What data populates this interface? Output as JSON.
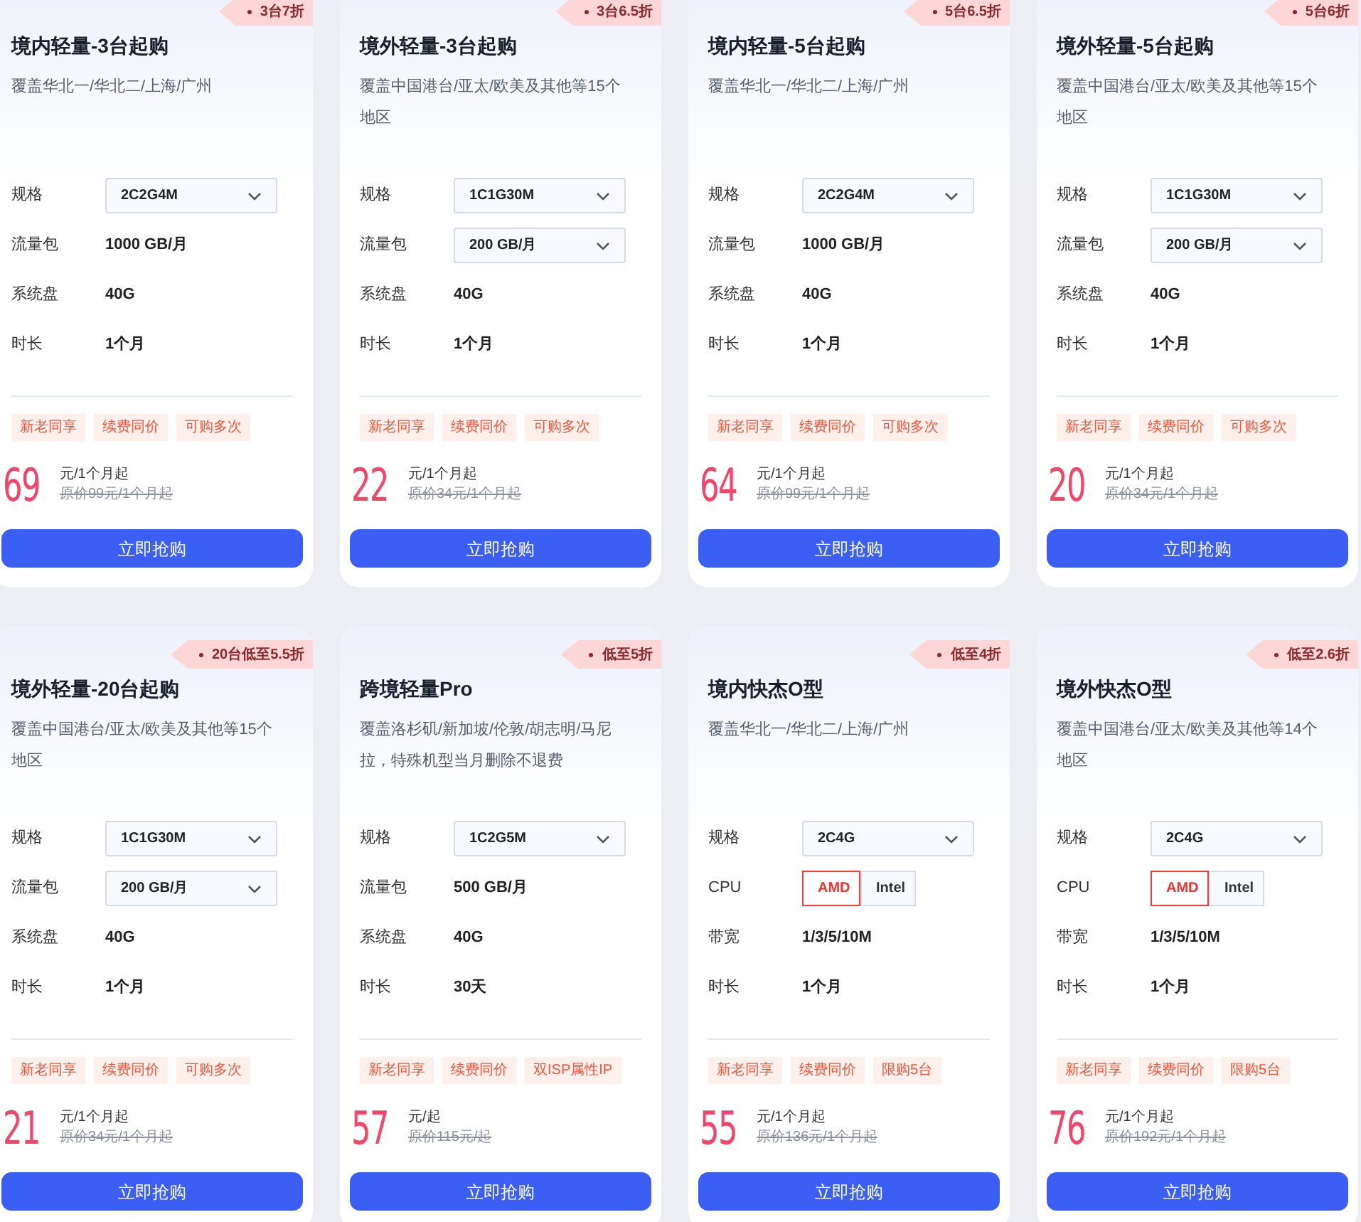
{
  "cards": [
    {
      "badge": "3台7折",
      "title": "境内轻量-3台起购",
      "description": "覆盖华北一/华北二/上海/广州",
      "specs": [
        {
          "label": "规格",
          "kind": "select",
          "value": "2C2G4M"
        },
        {
          "label": "流量包",
          "kind": "text",
          "value": "1000 GB/月"
        },
        {
          "label": "系统盘",
          "kind": "text",
          "value": "40G"
        },
        {
          "label": "时长",
          "kind": "text",
          "value": "1个月"
        }
      ],
      "tags": [
        "新老同享",
        "续费同价",
        "可购多次"
      ],
      "price": "69",
      "unit": "元/1个月起",
      "original_price": "原价99元/1个月起",
      "button": "立即抢购"
    },
    {
      "badge": "3台6.5折",
      "title": "境外轻量-3台起购",
      "description": "覆盖中国港台/亚太/欧美及其他等15个地区",
      "specs": [
        {
          "label": "规格",
          "kind": "select",
          "value": "1C1G30M"
        },
        {
          "label": "流量包",
          "kind": "select",
          "value": "200 GB/月"
        },
        {
          "label": "系统盘",
          "kind": "text",
          "value": "40G"
        },
        {
          "label": "时长",
          "kind": "text",
          "value": "1个月"
        }
      ],
      "tags": [
        "新老同享",
        "续费同价",
        "可购多次"
      ],
      "price": "22",
      "unit": "元/1个月起",
      "original_price": "原价34元/1个月起",
      "button": "立即抢购"
    },
    {
      "badge": "5台6.5折",
      "title": "境内轻量-5台起购",
      "description": "覆盖华北一/华北二/上海/广州",
      "specs": [
        {
          "label": "规格",
          "kind": "select",
          "value": "2C2G4M"
        },
        {
          "label": "流量包",
          "kind": "text",
          "value": "1000 GB/月"
        },
        {
          "label": "系统盘",
          "kind": "text",
          "value": "40G"
        },
        {
          "label": "时长",
          "kind": "text",
          "value": "1个月"
        }
      ],
      "tags": [
        "新老同享",
        "续费同价",
        "可购多次"
      ],
      "price": "64",
      "unit": "元/1个月起",
      "original_price": "原价99元/1个月起",
      "button": "立即抢购"
    },
    {
      "badge": "5台6折",
      "title": "境外轻量-5台起购",
      "description": "覆盖中国港台/亚太/欧美及其他等15个地区",
      "specs": [
        {
          "label": "规格",
          "kind": "select",
          "value": "1C1G30M"
        },
        {
          "label": "流量包",
          "kind": "select",
          "value": "200 GB/月"
        },
        {
          "label": "系统盘",
          "kind": "text",
          "value": "40G"
        },
        {
          "label": "时长",
          "kind": "text",
          "value": "1个月"
        }
      ],
      "tags": [
        "新老同享",
        "续费同价",
        "可购多次"
      ],
      "price": "20",
      "unit": "元/1个月起",
      "original_price": "原价34元/1个月起",
      "button": "立即抢购"
    },
    {
      "badge": "20台低至5.5折",
      "title": "境外轻量-20台起购",
      "description": "覆盖中国港台/亚太/欧美及其他等15个地区",
      "specs": [
        {
          "label": "规格",
          "kind": "select",
          "value": "1C1G30M"
        },
        {
          "label": "流量包",
          "kind": "select",
          "value": "200 GB/月"
        },
        {
          "label": "系统盘",
          "kind": "text",
          "value": "40G"
        },
        {
          "label": "时长",
          "kind": "text",
          "value": "1个月"
        }
      ],
      "tags": [
        "新老同享",
        "续费同价",
        "可购多次"
      ],
      "price": "21",
      "unit": "元/1个月起",
      "original_price": "原价34元/1个月起",
      "button": "立即抢购"
    },
    {
      "badge": "低至5折",
      "title": "跨境轻量Pro",
      "description": "覆盖洛杉矶/新加坡/伦敦/胡志明/马尼拉，特殊机型当月删除不退费",
      "specs": [
        {
          "label": "规格",
          "kind": "select",
          "value": "1C2G5M"
        },
        {
          "label": "流量包",
          "kind": "text",
          "value": "500 GB/月"
        },
        {
          "label": "系统盘",
          "kind": "text",
          "value": "40G"
        },
        {
          "label": "时长",
          "kind": "text",
          "value": "30天"
        }
      ],
      "tags": [
        "新老同享",
        "续费同价",
        "双ISP属性IP"
      ],
      "price": "57",
      "unit": "元/起",
      "original_price": "原价115元/起",
      "button": "立即抢购"
    },
    {
      "badge": "低至4折",
      "title": "境内快杰O型",
      "description": "覆盖华北一/华北二/上海/广州",
      "specs": [
        {
          "label": "规格",
          "kind": "select",
          "value": "2C4G"
        },
        {
          "label": "CPU",
          "kind": "choice",
          "options": [
            {
              "label": "AMD",
              "selected": true
            },
            {
              "label": "Intel",
              "selected": false
            }
          ]
        },
        {
          "label": "带宽",
          "kind": "text",
          "value": "1/3/5/10M"
        },
        {
          "label": "时长",
          "kind": "text",
          "value": "1个月"
        }
      ],
      "tags": [
        "新老同享",
        "续费同价",
        "限购5台"
      ],
      "price": "55",
      "unit": "元/1个月起",
      "original_price": "原价136元/1个月起",
      "button": "立即抢购"
    },
    {
      "badge": "低至2.6折",
      "title": "境外快杰O型",
      "description": "覆盖中国港台/亚太/欧美及其他等14个地区",
      "specs": [
        {
          "label": "规格",
          "kind": "select",
          "value": "2C4G"
        },
        {
          "label": "CPU",
          "kind": "choice",
          "options": [
            {
              "label": "AMD",
              "selected": true
            },
            {
              "label": "Intel",
              "selected": false
            }
          ]
        },
        {
          "label": "带宽",
          "kind": "text",
          "value": "1/3/5/10M"
        },
        {
          "label": "时长",
          "kind": "text",
          "value": "1个月"
        }
      ],
      "tags": [
        "新老同享",
        "续费同价",
        "限购5台"
      ],
      "price": "76",
      "unit": "元/1个月起",
      "original_price": "原价192元/1个月起",
      "button": "立即抢购"
    }
  ]
}
